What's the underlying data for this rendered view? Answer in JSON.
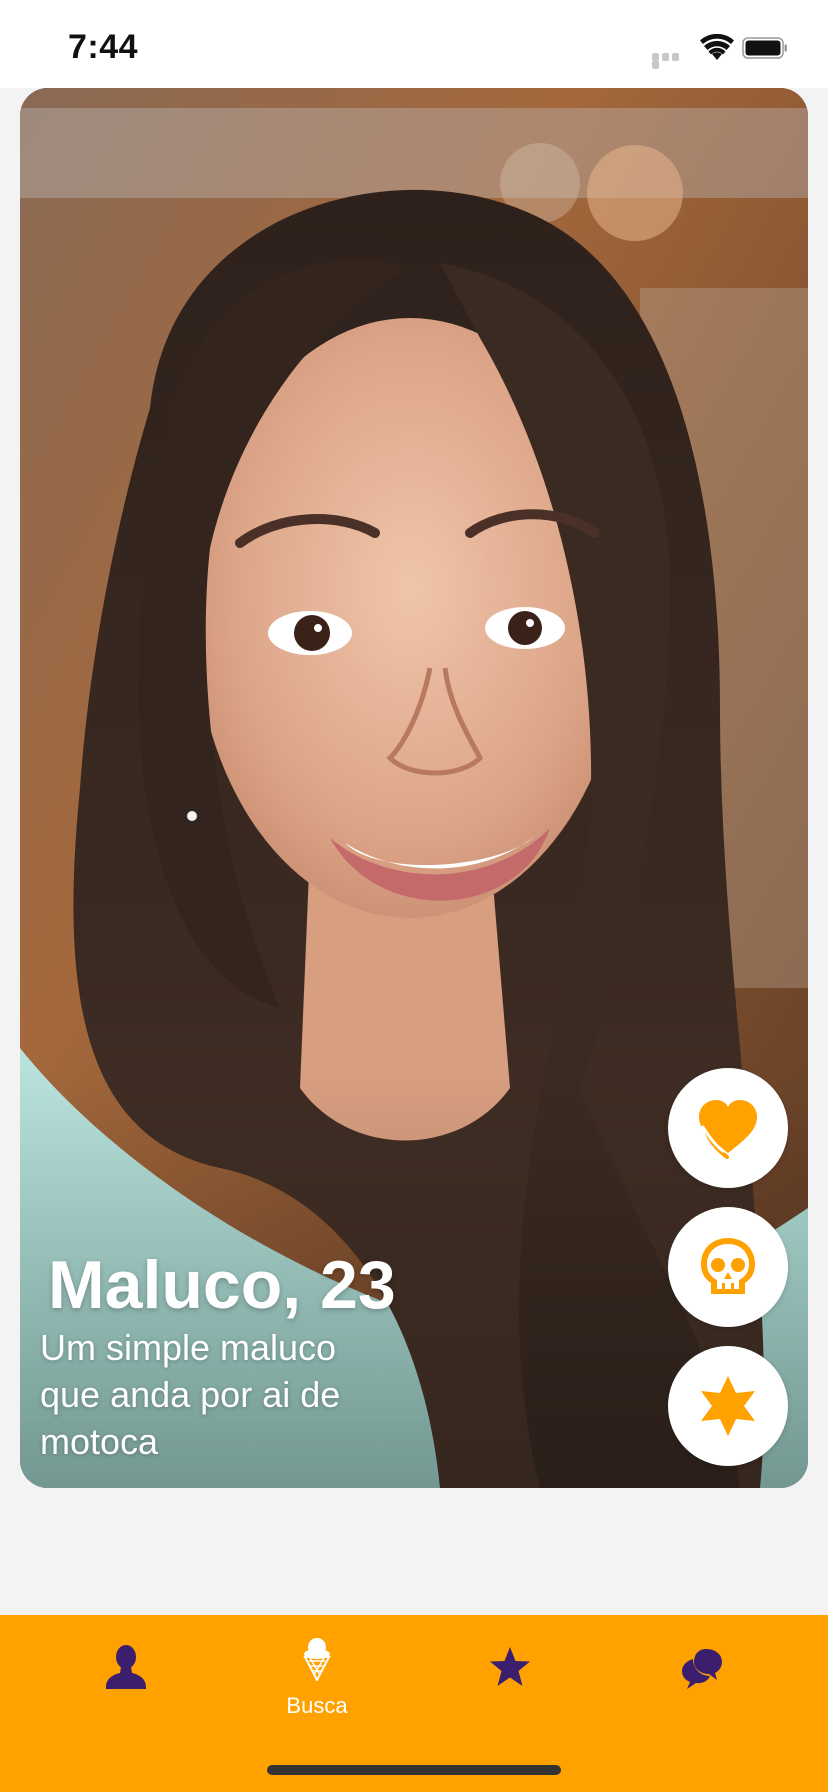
{
  "status_bar": {
    "time": "7:44"
  },
  "profile": {
    "name_age": "Maluco, 23",
    "bio": "Um simple maluco que anda por ai de motoca",
    "photo": "smiling-woman-portrait"
  },
  "actions": [
    {
      "icon": "heart-icon"
    },
    {
      "icon": "skull-icon"
    },
    {
      "icon": "star-burst-icon"
    }
  ],
  "tab_bar": {
    "tabs": [
      {
        "icon": "person-icon",
        "label": ""
      },
      {
        "icon": "ice-cream-icon",
        "label": "Busca",
        "active": true
      },
      {
        "icon": "star-icon",
        "label": ""
      },
      {
        "icon": "chat-bubbles-icon",
        "label": ""
      }
    ]
  },
  "colors": {
    "accent": "#ffa200",
    "icon_inactive": "#3b1f6e",
    "background": "#f3f3f3"
  }
}
